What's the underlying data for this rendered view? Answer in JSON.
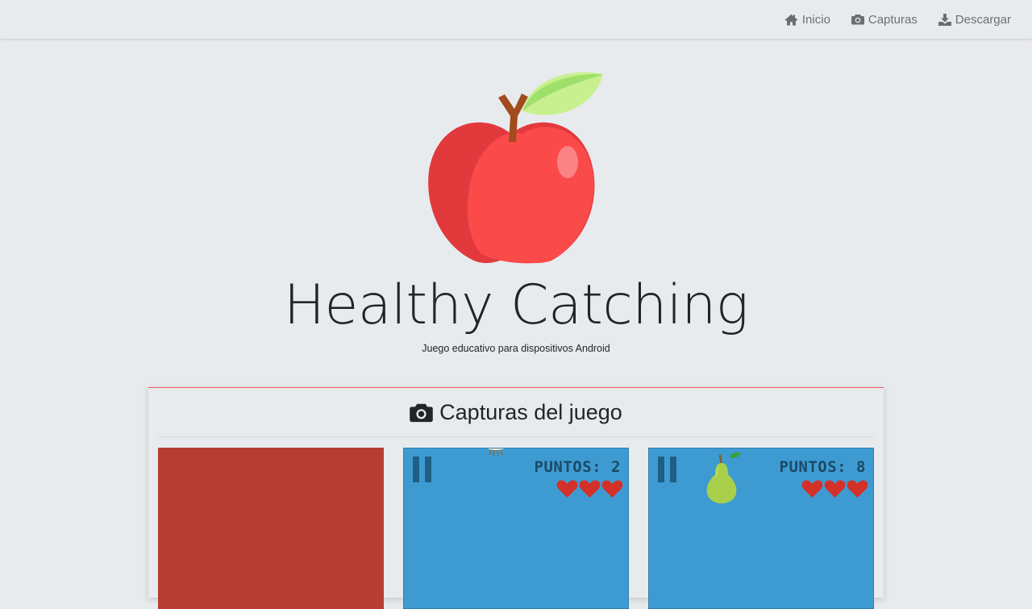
{
  "nav": {
    "items": [
      {
        "label": "Inicio",
        "icon": "home-icon"
      },
      {
        "label": "Capturas",
        "icon": "camera-icon"
      },
      {
        "label": "Descargar",
        "icon": "download-icon"
      }
    ]
  },
  "hero": {
    "logo": "apple-logo",
    "title": "Healthy Catching",
    "subtitle": "Juego educativo para dispositivos Android"
  },
  "gallery": {
    "title": "Capturas del juego",
    "icon": "camera-icon",
    "accent_color": "#ee5e55",
    "screenshots": [
      {
        "background": "#b73d32"
      },
      {
        "background": "#3d9bd2",
        "score_text": "PUNTOS: 2",
        "lives": 3,
        "fruit_icon": "onion-icon"
      },
      {
        "background": "#3d9bd2",
        "score_text": "PUNTOS: 8",
        "lives": 3,
        "fruit_icon": "pear-icon"
      }
    ]
  }
}
